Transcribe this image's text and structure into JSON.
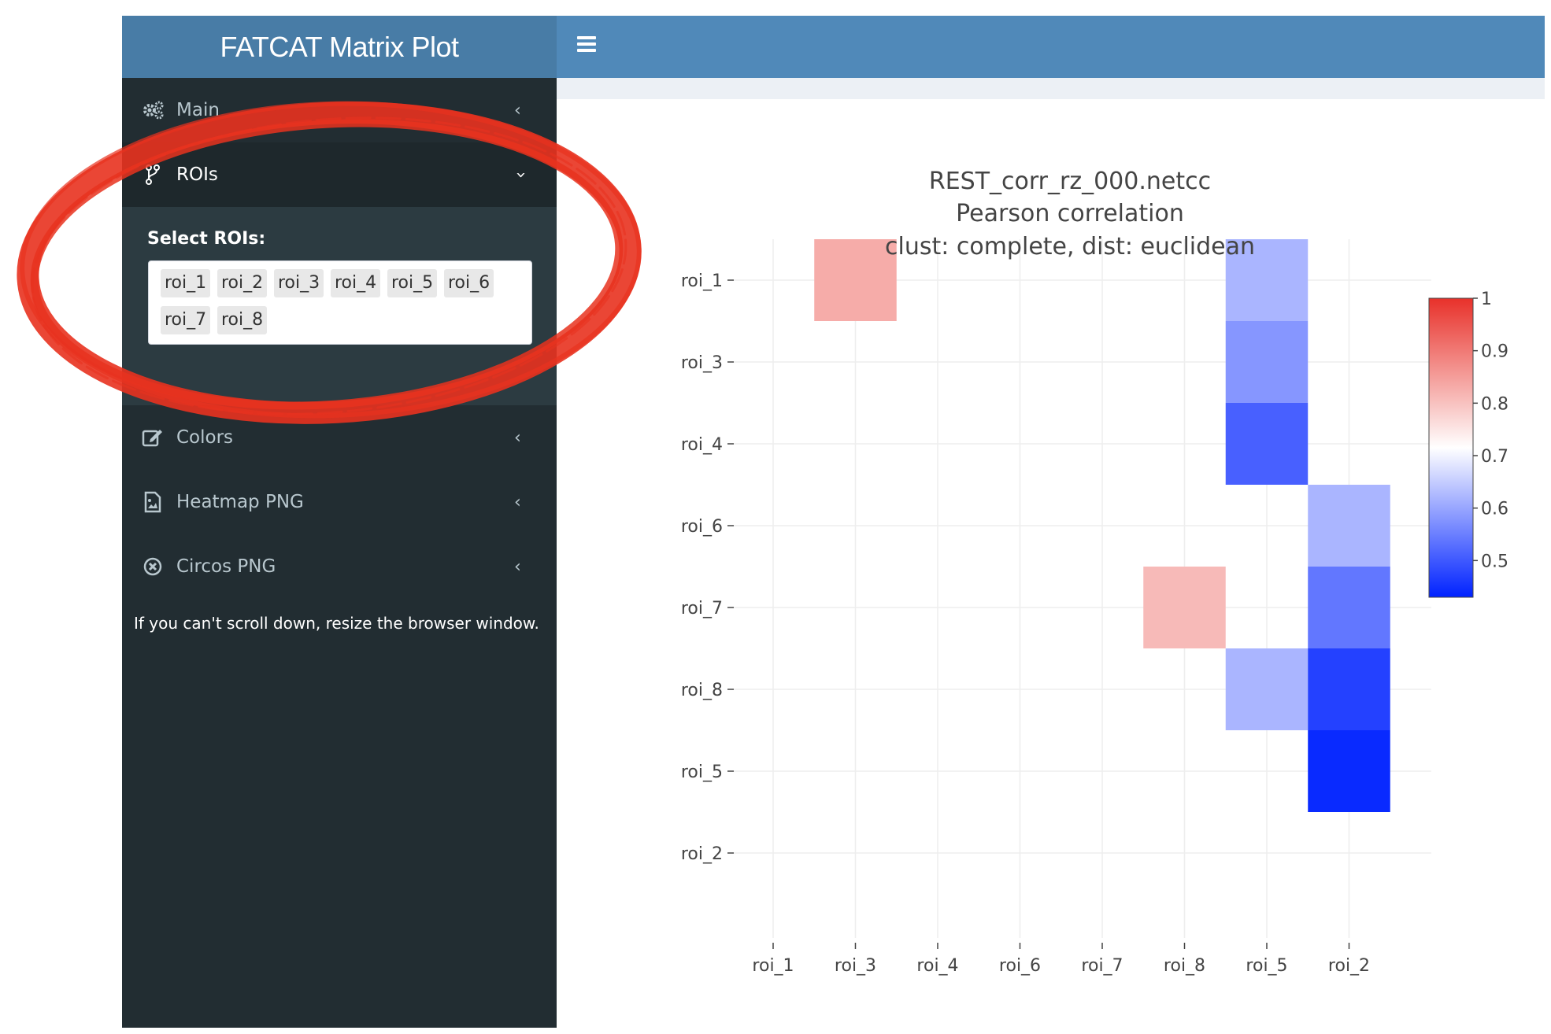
{
  "app": {
    "title": "FATCAT Matrix Plot"
  },
  "sidebar": {
    "items": [
      {
        "label": "Main",
        "icon": "gears-icon",
        "expanded": false
      },
      {
        "label": "ROIs",
        "icon": "code-fork-icon",
        "expanded": true
      },
      {
        "label": "Colors",
        "icon": "edit-icon",
        "expanded": false
      },
      {
        "label": "Heatmap PNG",
        "icon": "file-image-icon",
        "expanded": false
      },
      {
        "label": "Circos PNG",
        "icon": "times-circle-icon",
        "expanded": false
      }
    ],
    "roi_select": {
      "label": "Select ROIs:",
      "selected": [
        "roi_1",
        "roi_2",
        "roi_3",
        "roi_4",
        "roi_5",
        "roi_6",
        "roi_7",
        "roi_8"
      ]
    },
    "help_text": "If you can't scroll down, resize the browser window."
  },
  "annotation": {
    "color": "#e8321f",
    "shape": "hand-drawn ellipse around ROIs section"
  },
  "chart_data": {
    "type": "heatmap",
    "title_lines": [
      "REST_corr_rz_000.netcc",
      "Pearson correlation",
      "clust: complete, dist: euclidean"
    ],
    "x": [
      "roi_1",
      "roi_3",
      "roi_4",
      "roi_6",
      "roi_7",
      "roi_8",
      "roi_5",
      "roi_2"
    ],
    "y": [
      "roi_1",
      "roi_3",
      "roi_4",
      "roi_6",
      "roi_7",
      "roi_8",
      "roi_5",
      "roi_2"
    ],
    "cells": [
      {
        "x": "roi_3",
        "y": "roi_1",
        "value": 0.83
      },
      {
        "x": "roi_5",
        "y": "roi_1",
        "value": 0.62
      },
      {
        "x": "roi_5",
        "y": "roi_3",
        "value": 0.58
      },
      {
        "x": "roi_5",
        "y": "roi_4",
        "value": 0.51
      },
      {
        "x": "roi_2",
        "y": "roi_6",
        "value": 0.62
      },
      {
        "x": "roi_8",
        "y": "roi_7",
        "value": 0.81
      },
      {
        "x": "roi_2",
        "y": "roi_7",
        "value": 0.54
      },
      {
        "x": "roi_5",
        "y": "roi_8",
        "value": 0.62
      },
      {
        "x": "roi_2",
        "y": "roi_8",
        "value": 0.47
      },
      {
        "x": "roi_2",
        "y": "roi_5",
        "value": 0.44
      }
    ],
    "colorscale": {
      "min": 0.43,
      "max": 1.0,
      "low": "#0022ff",
      "mid": "#ffffff",
      "high": "#e8312a"
    },
    "colorbar_ticks": [
      "1",
      "0.9",
      "0.8",
      "0.7",
      "0.6",
      "0.5"
    ],
    "colorbar_tick_values": [
      1.0,
      0.9,
      0.8,
      0.7,
      0.6,
      0.5
    ],
    "grid": true
  }
}
